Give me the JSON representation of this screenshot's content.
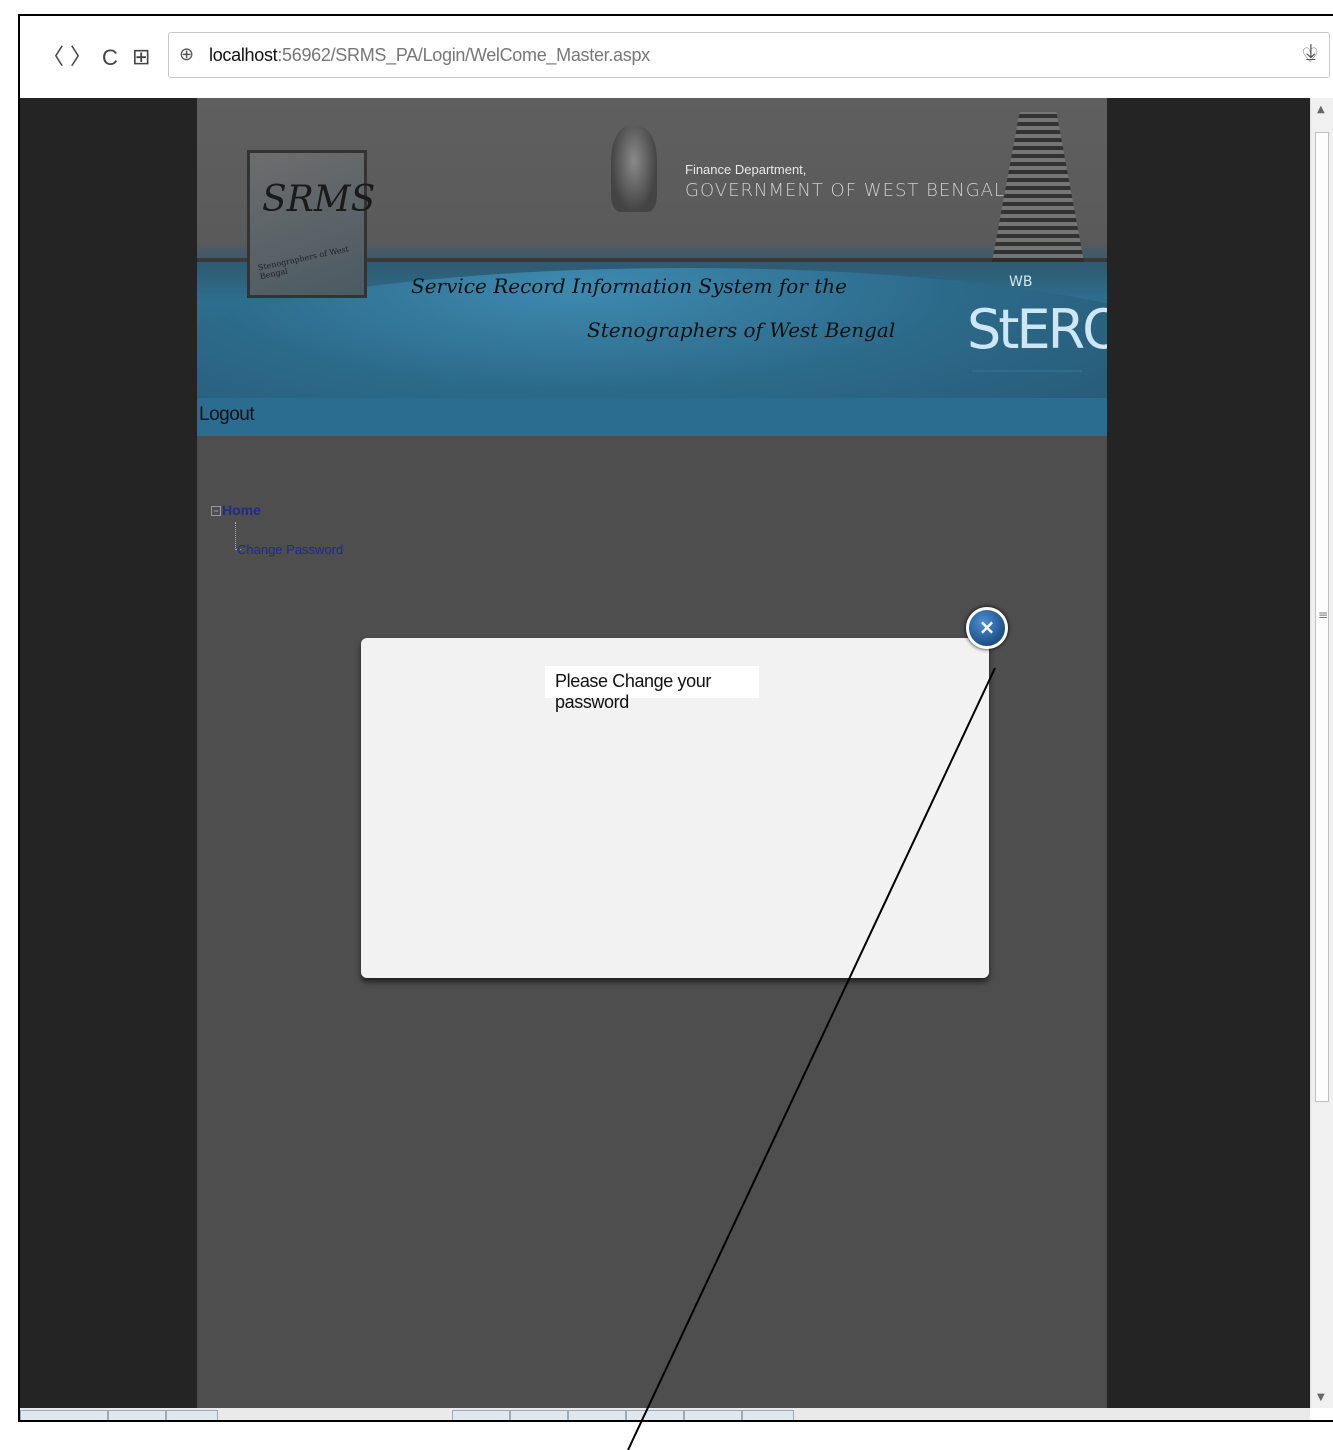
{
  "browser": {
    "back_label": "〈",
    "forward_label": "〉",
    "reload_label": "C",
    "apps_label": "⊞",
    "url_host": "localhost",
    "url_rest": ":56962/SRMS_PA/Login/WelCome_Master.aspx"
  },
  "banner": {
    "logo_text": "SRMS",
    "logo_ring_text": "Stenographers of West Bengal",
    "finance_department": "Finance Department,",
    "government": "GOVERNMENT OF WEST BENGAL",
    "tagline_line1": "Service Record Information System for the",
    "tagline_line2": "Stenographers of West Bengal",
    "stero_mark": "StERO",
    "stero_wb": "WB"
  },
  "menu": {
    "logout_label": "Logout"
  },
  "tree": {
    "home_label": "Home",
    "items": [
      {
        "label": "Change Password"
      }
    ]
  },
  "modal": {
    "message": "Please Change your password",
    "close_label": "×"
  },
  "colors": {
    "page_bg": "#4e4e4e",
    "viewport_bg": "#242424",
    "menubar": "#2b6d91",
    "link": "#1f2a8f",
    "close_button": "#1d4f8a"
  }
}
